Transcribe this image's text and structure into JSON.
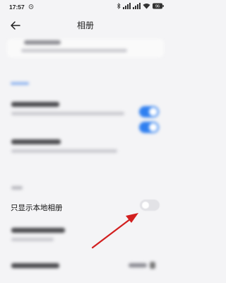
{
  "status_bar": {
    "time": "17:57",
    "battery": "96"
  },
  "header": {
    "title": "相册"
  },
  "settings": {
    "local_only_label": "只显示本地相册",
    "local_only_enabled": false
  },
  "colors": {
    "accent": "#2f7ff0",
    "arrow": "#d21f1f"
  }
}
